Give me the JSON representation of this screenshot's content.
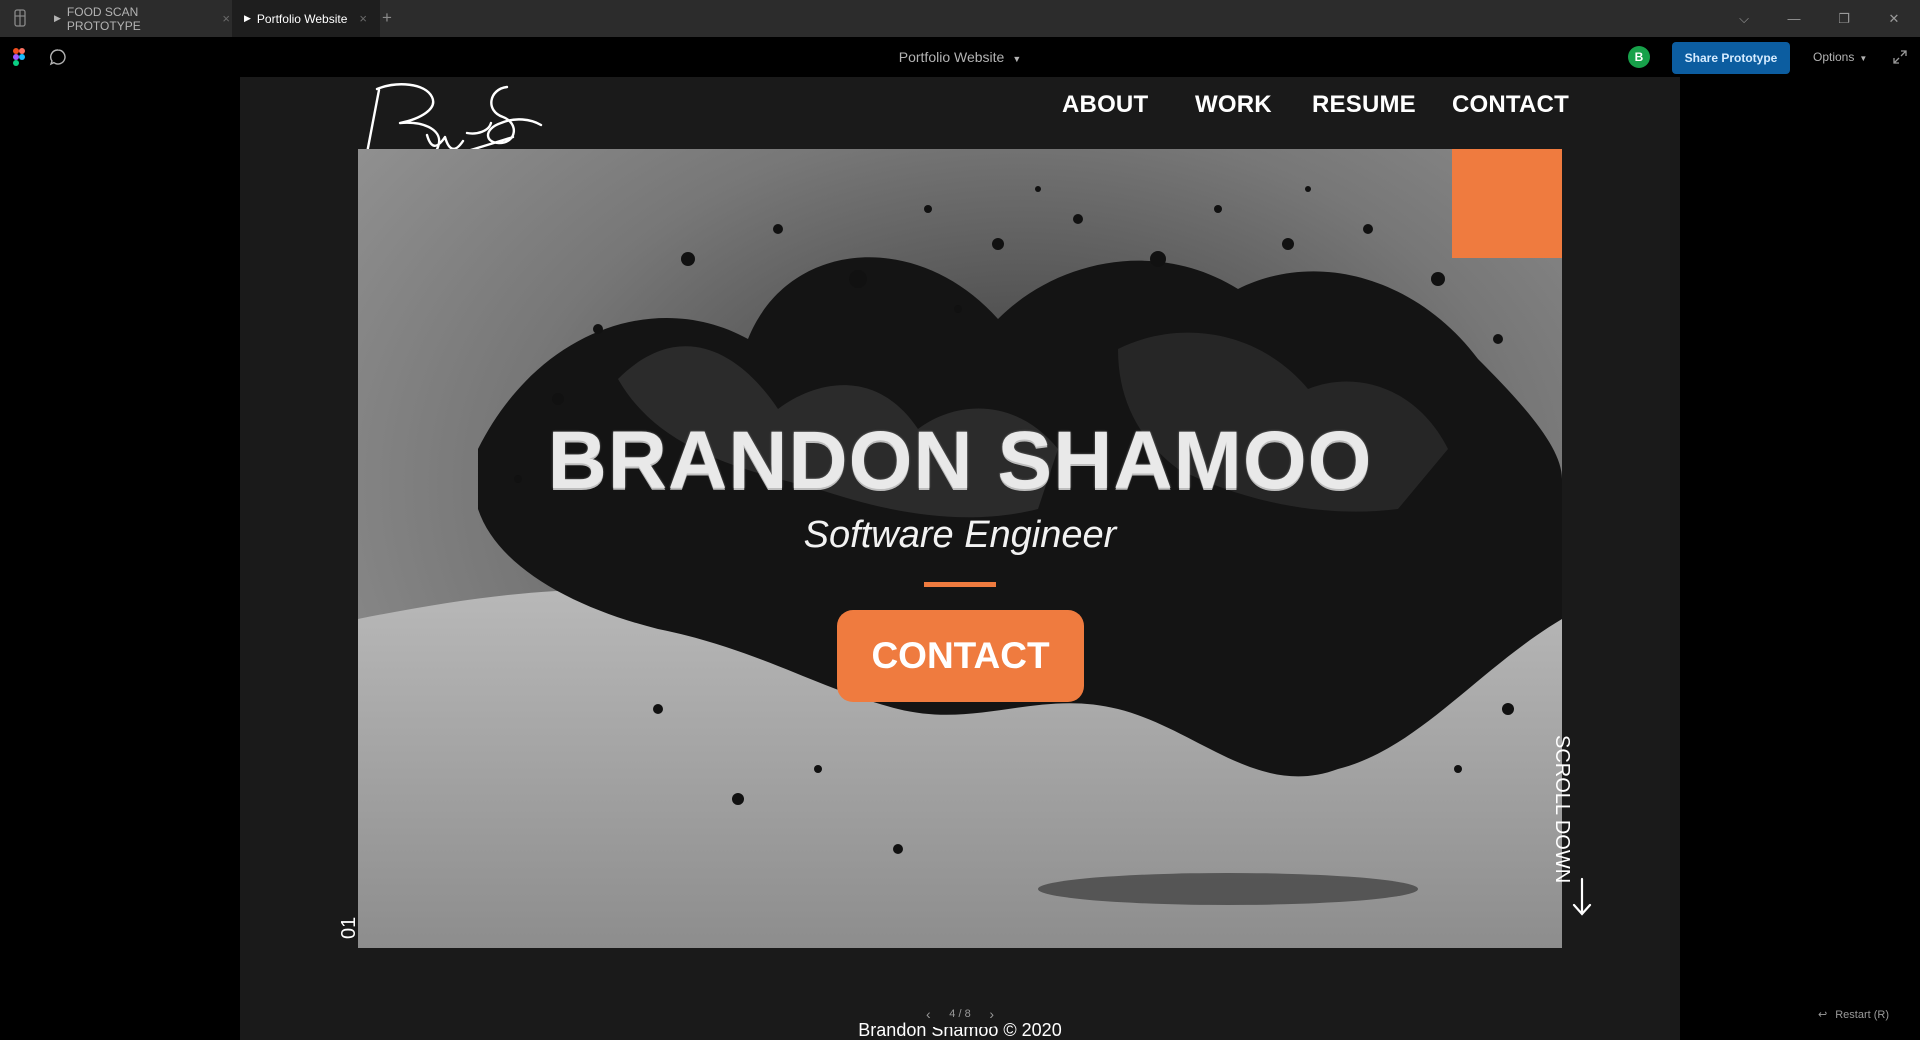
{
  "app": {
    "tabs": [
      {
        "label": "FOOD SCAN PROTOTYPE",
        "active": false
      },
      {
        "label": "Portfolio Website",
        "active": true
      }
    ],
    "add_tab": "+",
    "window_controls": {
      "dropdown": "⌵",
      "minimize": "—",
      "restore": "❐",
      "close": "✕"
    }
  },
  "toolbar": {
    "file_title": "Portfolio Website",
    "avatar_initial": "B",
    "share_label": "Share Prototype",
    "options_label": "Options"
  },
  "site": {
    "nav": [
      "ABOUT",
      "WORK",
      "RESUME",
      "CONTACT"
    ],
    "hero": {
      "name": "BRANDON SHAMOO",
      "role": "Software Engineer",
      "cta": "CONTACT"
    },
    "slide_number": "01",
    "scroll_label": "SCROLL DOWN",
    "footer": "Brandon Shamoo © 2020"
  },
  "player": {
    "page_indicator": "4 / 8",
    "restart_label": "Restart (R)"
  },
  "colors": {
    "accent": "#ef7b3f",
    "share_button": "#0c5da0",
    "avatar": "#17a14a",
    "frame_background": "#1a1a1a"
  }
}
